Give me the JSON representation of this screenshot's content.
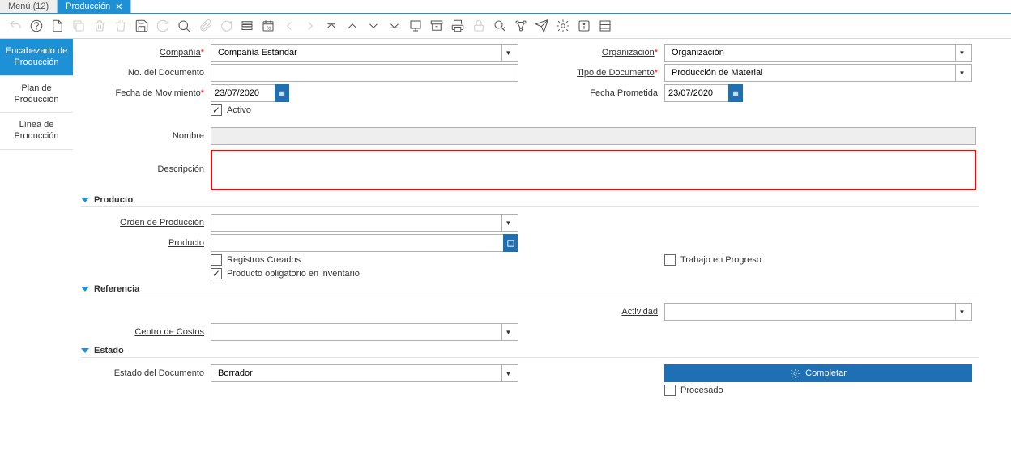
{
  "tabs": [
    {
      "label": "Menú (12)"
    },
    {
      "label": "Producción"
    }
  ],
  "sidebar": {
    "items": [
      {
        "label": "Encabezado de Producción"
      },
      {
        "label": "Plan de Producción"
      },
      {
        "label": "Línea de Producción"
      }
    ]
  },
  "header": {
    "compania": {
      "label": "Compañía",
      "value": "Compañía Estándar"
    },
    "organizacion": {
      "label": "Organización",
      "value": "Organización"
    },
    "nodoc": {
      "label": "No. del Documento",
      "value": ""
    },
    "tipodoc": {
      "label": "Tipo de Documento",
      "value": "Producción de Material"
    },
    "fechamov": {
      "label": "Fecha de Movimiento",
      "value": "23/07/2020"
    },
    "fechaprom": {
      "label": "Fecha Prometida",
      "value": "23/07/2020"
    },
    "activo": {
      "label": "Activo",
      "checked": true
    },
    "nombre": {
      "label": "Nombre",
      "value": ""
    },
    "descripcion": {
      "label": "Descripción",
      "value": ""
    }
  },
  "sections": {
    "producto": {
      "title": "Producto",
      "orden": {
        "label": "Orden de Producción",
        "value": ""
      },
      "producto": {
        "label": "Producto",
        "value": ""
      },
      "registros": {
        "label": "Registros Creados",
        "checked": false
      },
      "trabajo": {
        "label": "Trabajo en Progreso",
        "checked": false
      },
      "obligatorio": {
        "label": "Producto obligatorio en inventario",
        "checked": true
      }
    },
    "referencia": {
      "title": "Referencia",
      "actividad": {
        "label": "Actividad",
        "value": ""
      },
      "centrocostos": {
        "label": "Centro de Costos",
        "value": ""
      }
    },
    "estado": {
      "title": "Estado",
      "estadodoc": {
        "label": "Estado del Documento",
        "value": "Borrador"
      },
      "completar": {
        "label": "Completar"
      },
      "procesado": {
        "label": "Procesado",
        "checked": false
      }
    }
  }
}
